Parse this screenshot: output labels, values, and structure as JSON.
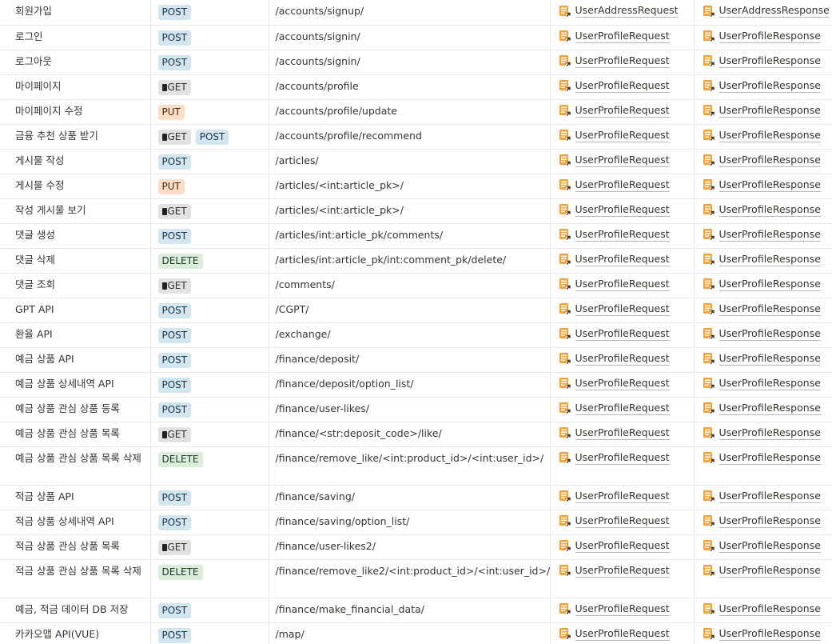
{
  "rows": [
    {
      "name": "회원가입",
      "methods": [
        "POST"
      ],
      "url": "/accounts/signup/",
      "request": "UserAddressRequest",
      "response": "UserAddressResponse"
    },
    {
      "name": "로그인",
      "methods": [
        "POST"
      ],
      "url": "/accounts/signin/",
      "request": "UserProfileRequest",
      "response": "UserProfileResponse"
    },
    {
      "name": "로그아웃",
      "methods": [
        "POST"
      ],
      "url": "/accounts/signin/",
      "request": "UserProfileRequest",
      "response": "UserProfileResponse"
    },
    {
      "name": "마이페이지",
      "methods": [
        "GET"
      ],
      "url": "/accounts/profile",
      "request": "UserProfileRequest",
      "response": "UserProfileResponse"
    },
    {
      "name": "마이페이지 수정",
      "methods": [
        "PUT"
      ],
      "url": "/accounts/profile/update",
      "request": "UserProfileRequest",
      "response": "UserProfileResponse"
    },
    {
      "name": "금융 추천 상품 받기",
      "methods": [
        "GET",
        "POST"
      ],
      "url": "/accounts/profile/recommend",
      "request": "UserProfileRequest",
      "response": "UserProfileResponse"
    },
    {
      "name": "게시물 작성",
      "methods": [
        "POST"
      ],
      "url": "/articles/",
      "request": "UserProfileRequest",
      "response": "UserProfileResponse"
    },
    {
      "name": "게시물 수정",
      "methods": [
        "PUT"
      ],
      "url": "/articles/<int:article_pk>/",
      "request": "UserProfileRequest",
      "response": "UserProfileResponse"
    },
    {
      "name": "작성 게시물 보기",
      "methods": [
        "GET"
      ],
      "url": "/articles/<int:article_pk>/",
      "request": "UserProfileRequest",
      "response": "UserProfileResponse"
    },
    {
      "name": "댓글 생성",
      "methods": [
        "POST"
      ],
      "url": "/articles/int:article_pk/comments/",
      "request": "UserProfileRequest",
      "response": "UserProfileResponse"
    },
    {
      "name": "댓글 삭제",
      "methods": [
        "DELETE"
      ],
      "url": "/articles/int:article_pk/int:comment_pk/delete/",
      "request": "UserProfileRequest",
      "response": "UserProfileResponse"
    },
    {
      "name": "댓글 조회",
      "methods": [
        "GET"
      ],
      "url": "/comments/",
      "request": "UserProfileRequest",
      "response": "UserProfileResponse"
    },
    {
      "name": "GPT API",
      "methods": [
        "POST"
      ],
      "url": "/CGPT/",
      "request": "UserProfileRequest",
      "response": "UserProfileResponse"
    },
    {
      "name": "환율 API",
      "methods": [
        "POST"
      ],
      "url": "/exchange/",
      "request": "UserProfileRequest",
      "response": "UserProfileResponse"
    },
    {
      "name": "예금 상품 API",
      "methods": [
        "POST"
      ],
      "url": "/finance/deposit/",
      "request": "UserProfileRequest",
      "response": "UserProfileResponse"
    },
    {
      "name": "예금 상품 상세내역 API",
      "methods": [
        "POST"
      ],
      "url": "/finance/deposit/option_list/",
      "request": "UserProfileRequest",
      "response": "UserProfileResponse"
    },
    {
      "name": "예금 상품 관심 상품 등록",
      "methods": [
        "POST"
      ],
      "url": "/finance/user-likes/",
      "request": "UserProfileRequest",
      "response": "UserProfileResponse"
    },
    {
      "name": "예금 상품 관심 상품 목록",
      "methods": [
        "GET"
      ],
      "url": "/finance/<str:deposit_code>/like/",
      "request": "UserProfileRequest",
      "response": "UserProfileResponse"
    },
    {
      "name": "예금 상품 관심 상품 목록 삭제",
      "methods": [
        "DELETE"
      ],
      "url": "/finance/remove_like/<int:product_id>/<int:user_id>/",
      "request": "UserProfileRequest",
      "response": "UserProfileResponse",
      "tall": true
    },
    {
      "name": "적금 상품 API",
      "methods": [
        "POST"
      ],
      "url": "/finance/saving/",
      "request": "UserProfileRequest",
      "response": "UserProfileResponse"
    },
    {
      "name": "적금 상품 상세내역 API",
      "methods": [
        "POST"
      ],
      "url": "/finance/saving/option_list/",
      "request": "UserProfileRequest",
      "response": "UserProfileResponse"
    },
    {
      "name": "적금 상품 관심 상품 목록",
      "methods": [
        "GET"
      ],
      "url": "/finance/user-likes2/",
      "request": "UserProfileRequest",
      "response": "UserProfileResponse"
    },
    {
      "name": "적금 상품 관심 상품 목록 삭제",
      "methods": [
        "DELETE"
      ],
      "url": "/finance/remove_like2/<int:product_id>/<int:user_id>/",
      "request": "UserProfileRequest",
      "response": "UserProfileResponse",
      "tall": true
    },
    {
      "name": "예금, 적금 데이터 DB 저장",
      "methods": [
        "POST"
      ],
      "url": "/finance/make_financial_data/",
      "request": "UserProfileRequest",
      "response": "UserProfileResponse"
    },
    {
      "name": "카카오맵 API(VUE)",
      "methods": [
        "POST"
      ],
      "url": "/map/",
      "request": "UserProfileRequest",
      "response": "UserProfileResponse"
    }
  ]
}
